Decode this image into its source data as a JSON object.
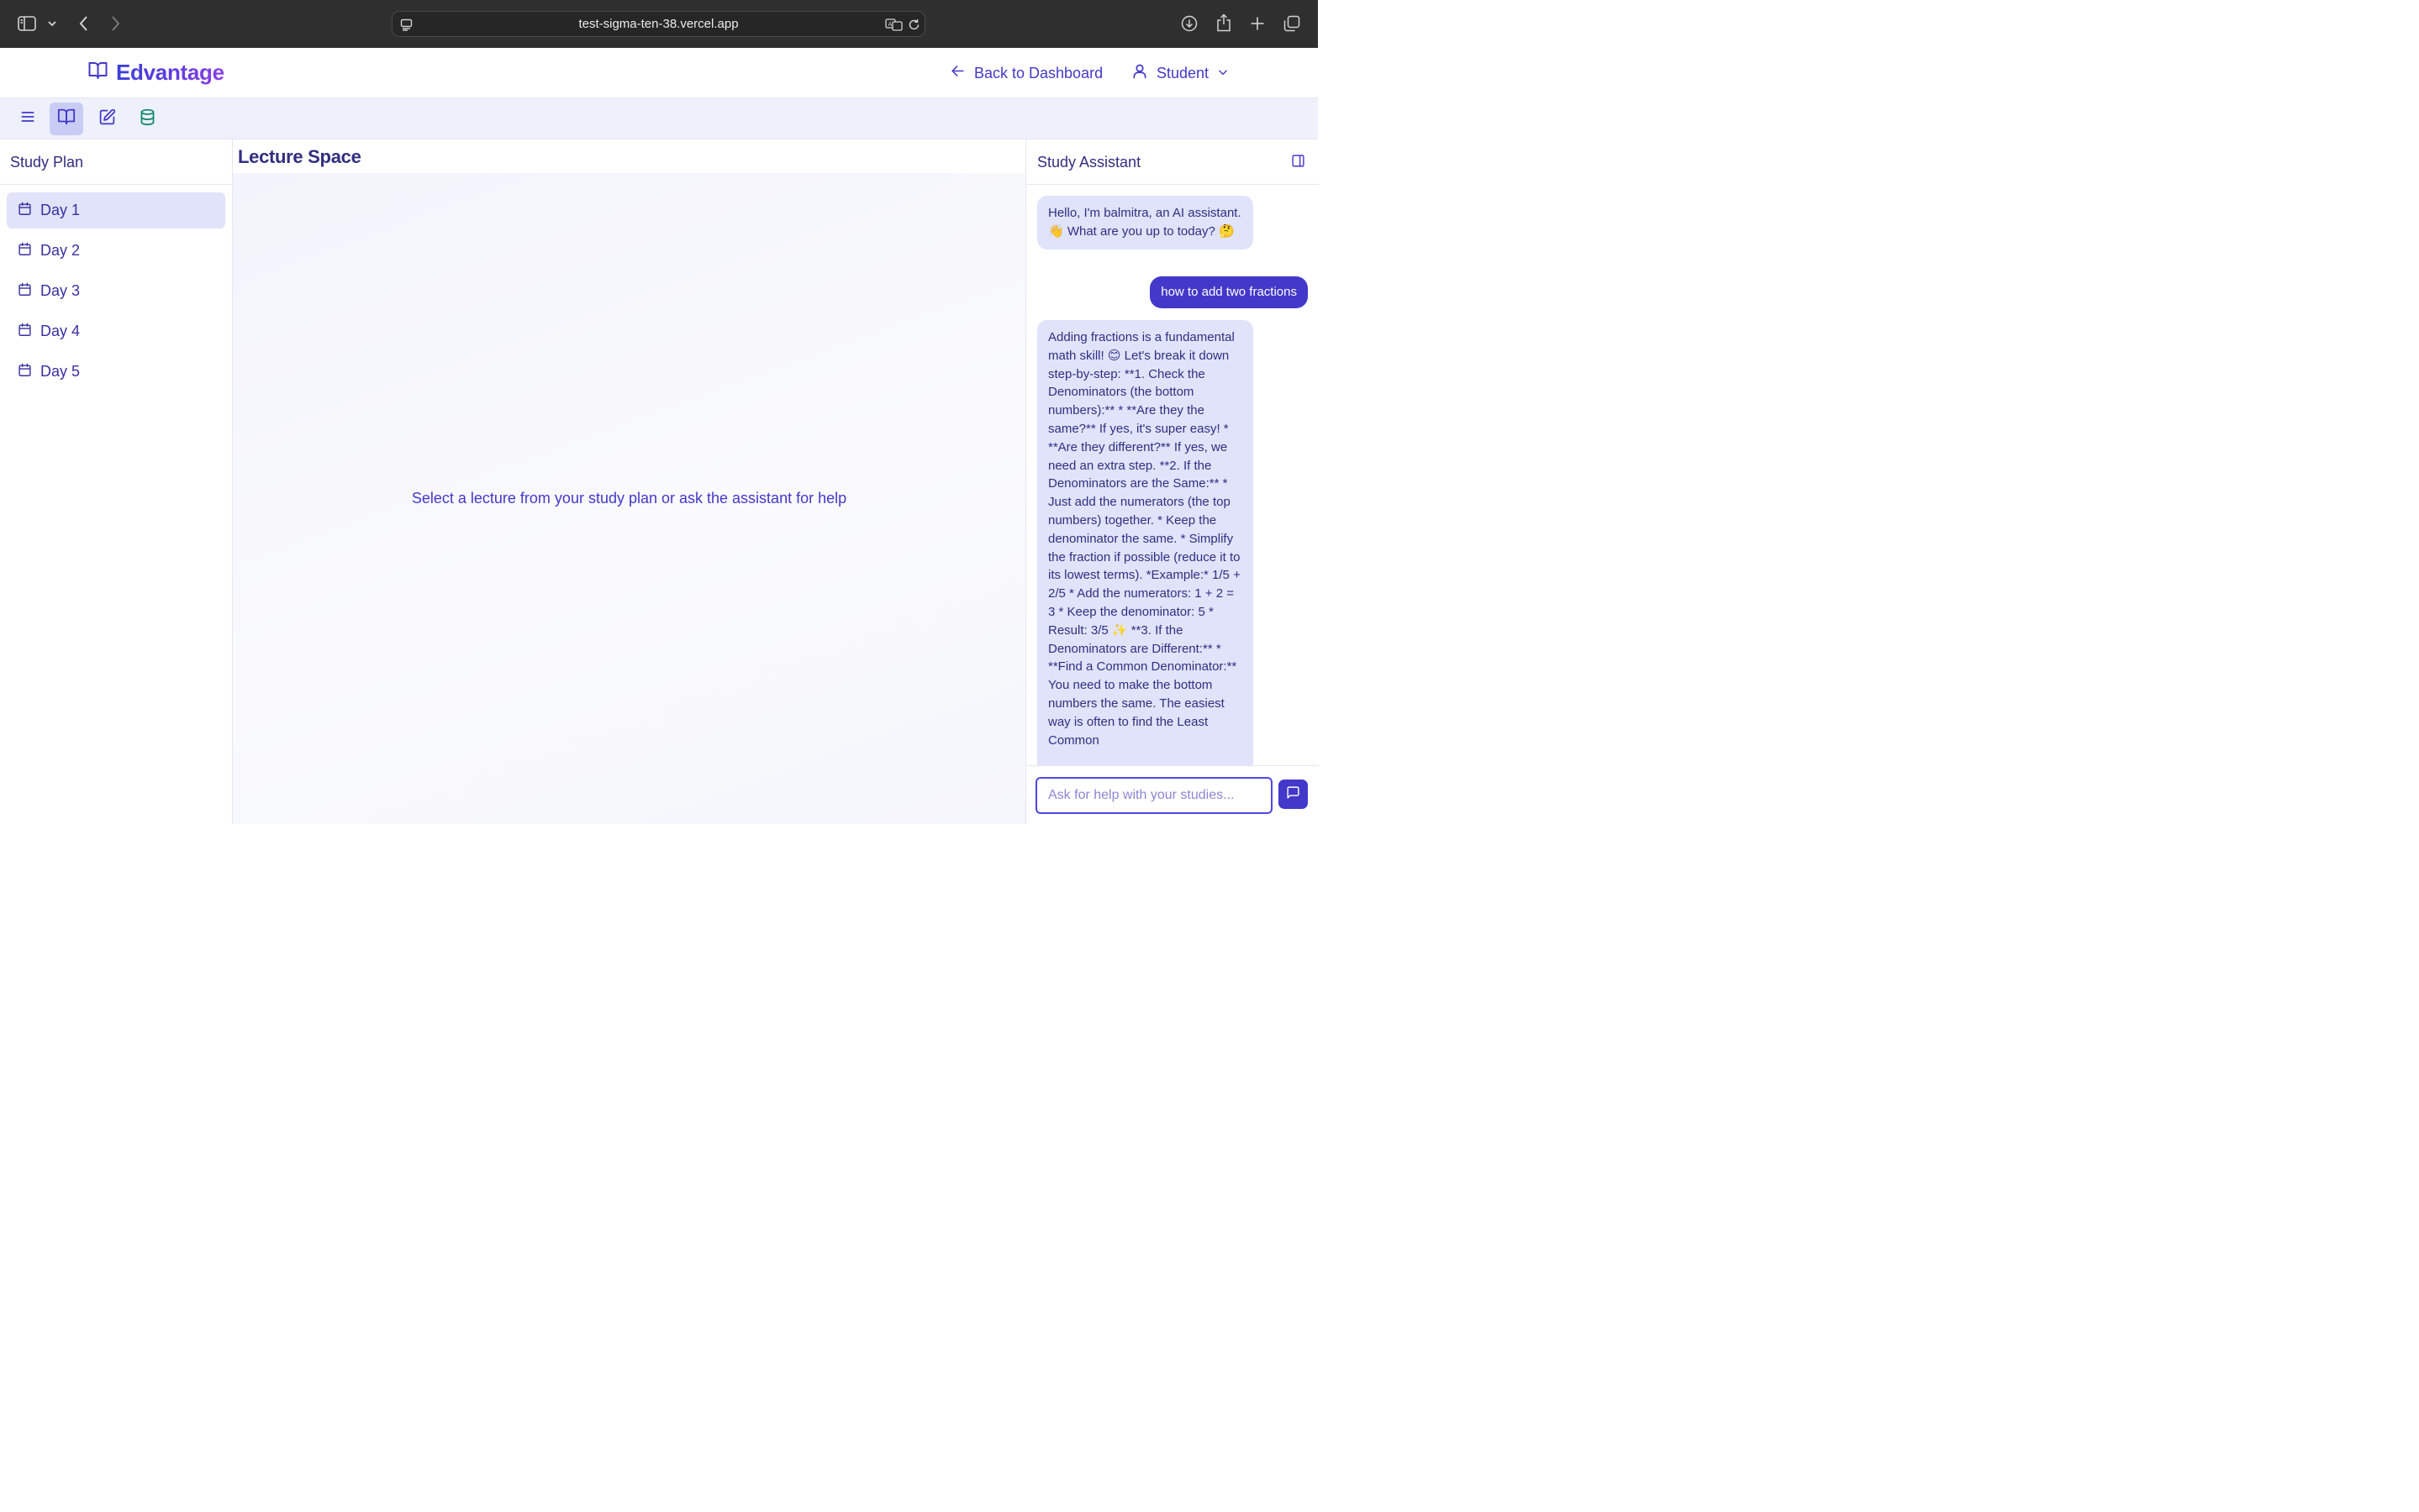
{
  "browser": {
    "url": "test-sigma-ten-38.vercel.app"
  },
  "header": {
    "brand": "Edvantage",
    "back_label": "Back to Dashboard",
    "user_label": "Student"
  },
  "sidebar": {
    "title": "Study Plan",
    "items": [
      {
        "label": "Day 1",
        "active": true
      },
      {
        "label": "Day 2",
        "active": false
      },
      {
        "label": "Day 3",
        "active": false
      },
      {
        "label": "Day 4",
        "active": false
      },
      {
        "label": "Day 5",
        "active": false
      }
    ]
  },
  "main": {
    "title": "Lecture Space",
    "hint": "Select a lecture from your study plan or ask the assistant for help"
  },
  "assistant": {
    "title": "Study Assistant",
    "messages": [
      {
        "role": "assistant",
        "text": "Hello, I'm balmitra, an AI assistant. 👋 What are you up to today? 🤔"
      },
      {
        "role": "user",
        "text": "how to add two fractions"
      },
      {
        "role": "assistant",
        "text": "Adding fractions is a fundamental math skill! 😊 Let's break it down step-by-step: **1. Check the Denominators (the bottom numbers):** * **Are they the same?** If yes, it's super easy! * **Are they different?** If yes, we need an extra step. **2. If the Denominators are the Same:** * Just add the numerators (the top numbers) together. * Keep the denominator the same. * Simplify the fraction if possible (reduce it to its lowest terms). *Example:* 1/5 + 2/5 * Add the numerators: 1 + 2 = 3 * Keep the denominator: 5 * Result: 3/5 ✨ **3. If the Denominators are Different:** * **Find a Common Denominator:** You need to make the bottom numbers the same. The easiest way is often to find the Least Common"
      }
    ],
    "input_placeholder": "Ask for help with your studies..."
  },
  "colors": {
    "accent": "#4338ca",
    "accent_light": "#e0e3fa",
    "toolbar_bg": "#eef0fb",
    "heading": "#312e81"
  }
}
